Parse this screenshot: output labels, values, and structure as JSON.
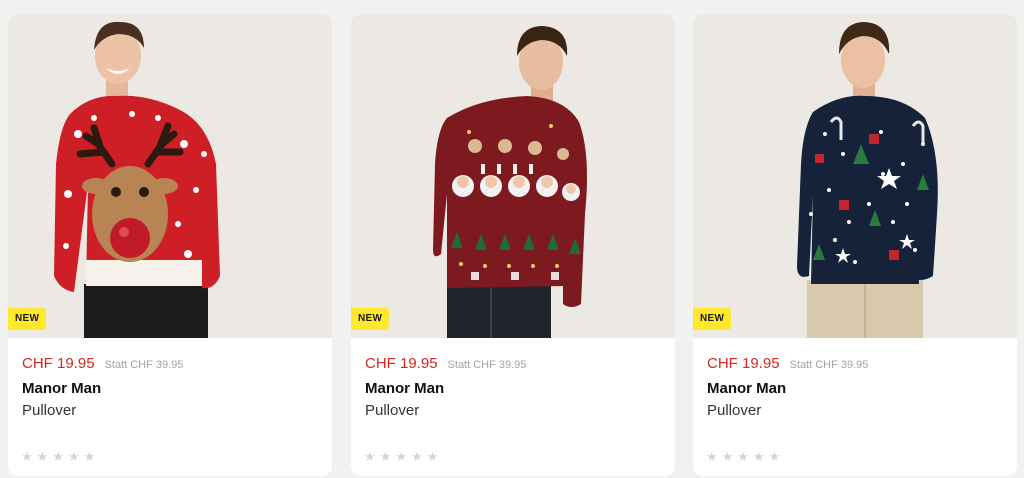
{
  "products": [
    {
      "badge": "NEW",
      "price": "CHF 19.95",
      "old_price": "Statt CHF 39.95",
      "brand": "Manor Man",
      "category": "Pullover",
      "rating": 0,
      "image_alt": "Red Christmas pullover with reindeer",
      "sweater_color": "#cf1f26",
      "pants_color": "#1c1c1c"
    },
    {
      "badge": "NEW",
      "price": "CHF 19.95",
      "old_price": "Statt CHF 39.95",
      "brand": "Manor Man",
      "category": "Pullover",
      "rating": 0,
      "image_alt": "Dark red Christmas pullover with Santas and reindeer",
      "sweater_color": "#7d1a20",
      "pants_color": "#20242c"
    },
    {
      "badge": "NEW",
      "price": "CHF 19.95",
      "old_price": "Statt CHF 39.95",
      "brand": "Manor Man",
      "category": "Pullover",
      "rating": 0,
      "image_alt": "Navy Christmas pullover with stars and gifts",
      "sweater_color": "#16213a",
      "pants_color": "#d9c9ac"
    }
  ],
  "colors": {
    "price": "#d4271f",
    "badge_bg": "#ffe82d",
    "star_empty": "#d5d5d5"
  },
  "star_glyph": "★★★★★"
}
